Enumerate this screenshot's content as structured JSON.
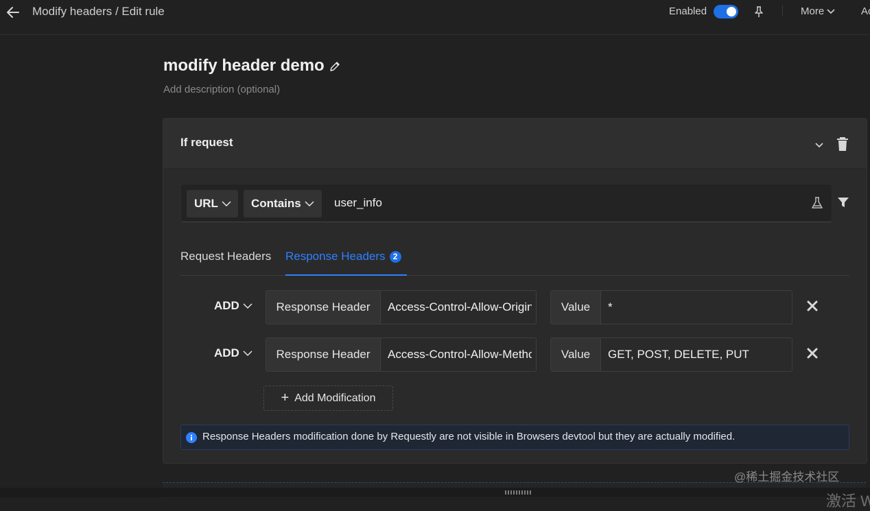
{
  "header": {
    "breadcrumb": "Modify headers / Edit rule",
    "enabled_label": "Enabled",
    "enabled": true,
    "more_label": "More",
    "cut_label": "Ac"
  },
  "rule": {
    "name": "modify header demo",
    "description_placeholder": "Add description (optional)"
  },
  "condition": {
    "title": "If request",
    "source_key": "URL",
    "operator": "Contains",
    "value": "user_info"
  },
  "tabs": [
    {
      "label": "Request Headers",
      "active": false
    },
    {
      "label": "Response Headers",
      "active": true,
      "count": "2"
    }
  ],
  "modifications": [
    {
      "action": "ADD",
      "header_label": "Response Header",
      "header": "Access-Control-Allow-Origin",
      "value_label": "Value",
      "value": "*"
    },
    {
      "action": "ADD",
      "header_label": "Response Header",
      "header": "Access-Control-Allow-Methods",
      "value_label": "Value",
      "value": "GET, POST, DELETE, PUT"
    }
  ],
  "add_modification_label": "Add Modification",
  "info_message": "Response Headers modification done by Requestly are not visible in Browsers devtool but they are actually modified.",
  "overlay": {
    "watermark": "@稀土掘金技术社区",
    "activate": "激活 W"
  },
  "colors": {
    "accent": "#1f6fe5",
    "background": "#212121",
    "panel": "#2a2a2a"
  }
}
